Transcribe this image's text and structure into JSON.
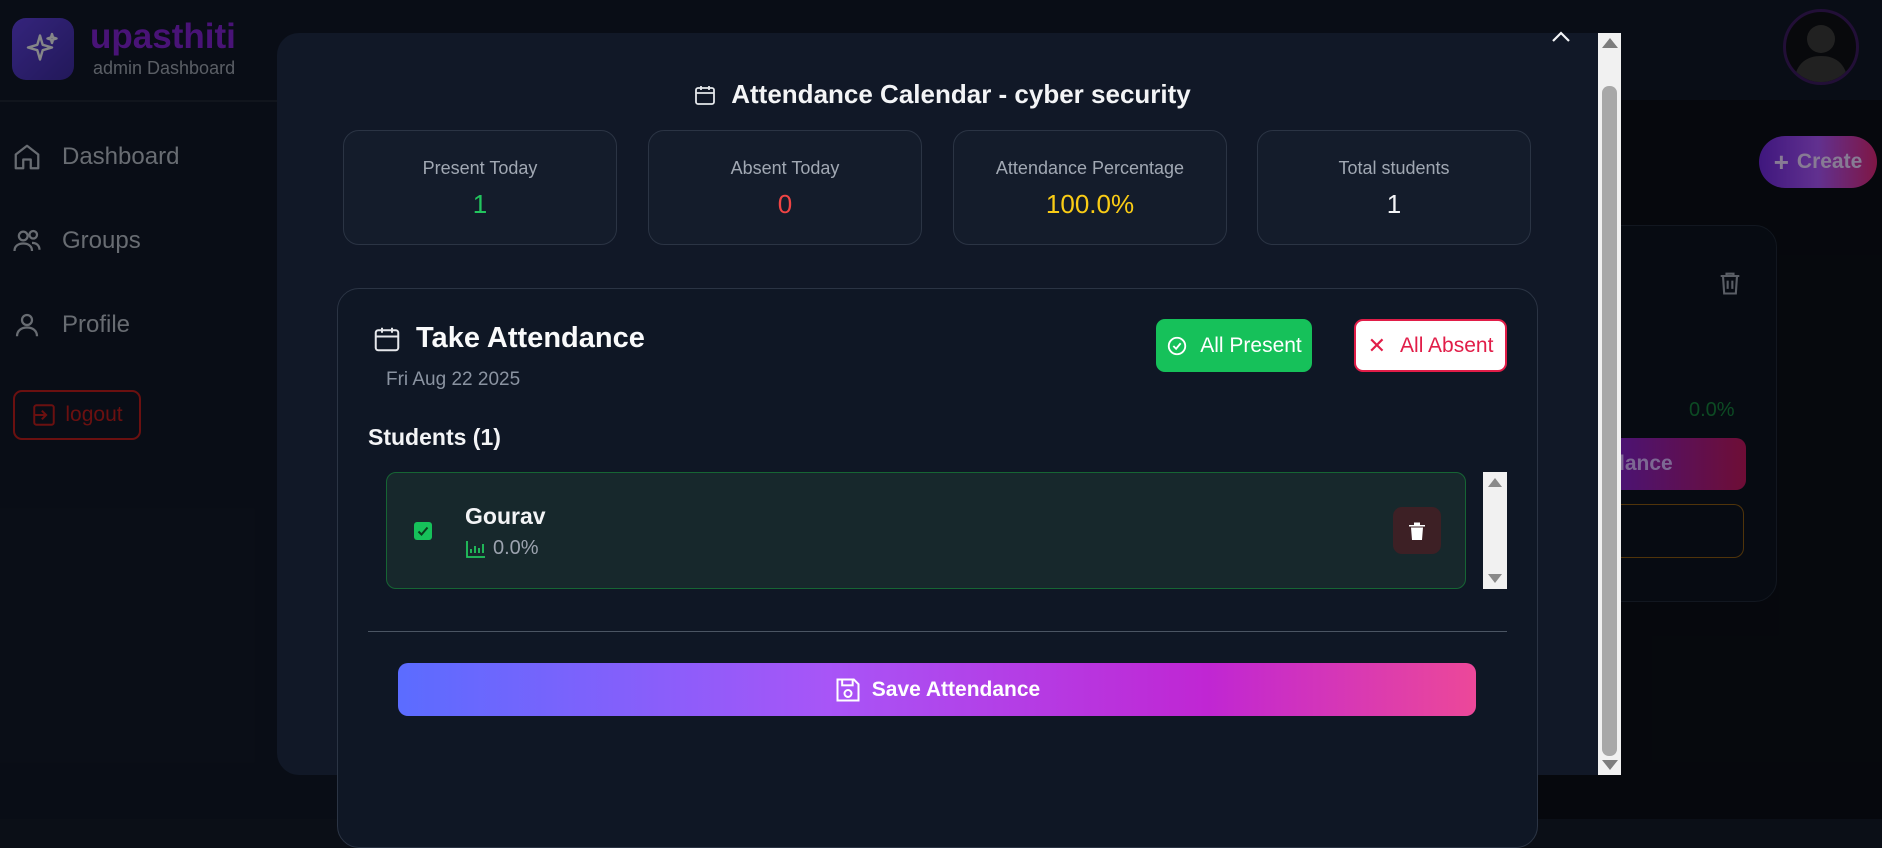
{
  "app": {
    "brand_name": "upasthiti",
    "brand_subtitle": "admin Dashboard"
  },
  "sidebar": {
    "items": [
      {
        "label": "Dashboard",
        "icon": "home-icon"
      },
      {
        "label": "Groups",
        "icon": "users-icon"
      },
      {
        "label": "Profile",
        "icon": "user-icon"
      }
    ],
    "logout_label": "logout"
  },
  "header": {
    "create_label": "Create"
  },
  "background_card": {
    "percentage": "0.0%",
    "button_label_fragment": "dance"
  },
  "modal": {
    "title": "Attendance Calendar - cyber security",
    "close_icon": "chevron-up-icon",
    "stats": [
      {
        "label": "Present Today",
        "value": "1",
        "color": "#22c55e"
      },
      {
        "label": "Absent Today",
        "value": "0",
        "color": "#ef4444"
      },
      {
        "label": "Attendance Percentage",
        "value": "100.0%",
        "color": "#facc15"
      },
      {
        "label": "Total students",
        "value": "1",
        "color": "#f3f4f6"
      }
    ],
    "take_attendance": {
      "title": "Take Attendance",
      "date": "Fri Aug 22 2025",
      "all_present_label": "All Present",
      "all_absent_label": "All Absent"
    },
    "students_heading": "Students (1)",
    "students": [
      {
        "name": "Gourav",
        "percentage": "0.0%",
        "checked": true
      }
    ],
    "save_label": "Save Attendance"
  },
  "colors": {
    "accent_purple": "#7e22ce",
    "present_green": "#16c15a",
    "absent_red": "#e11d48"
  }
}
